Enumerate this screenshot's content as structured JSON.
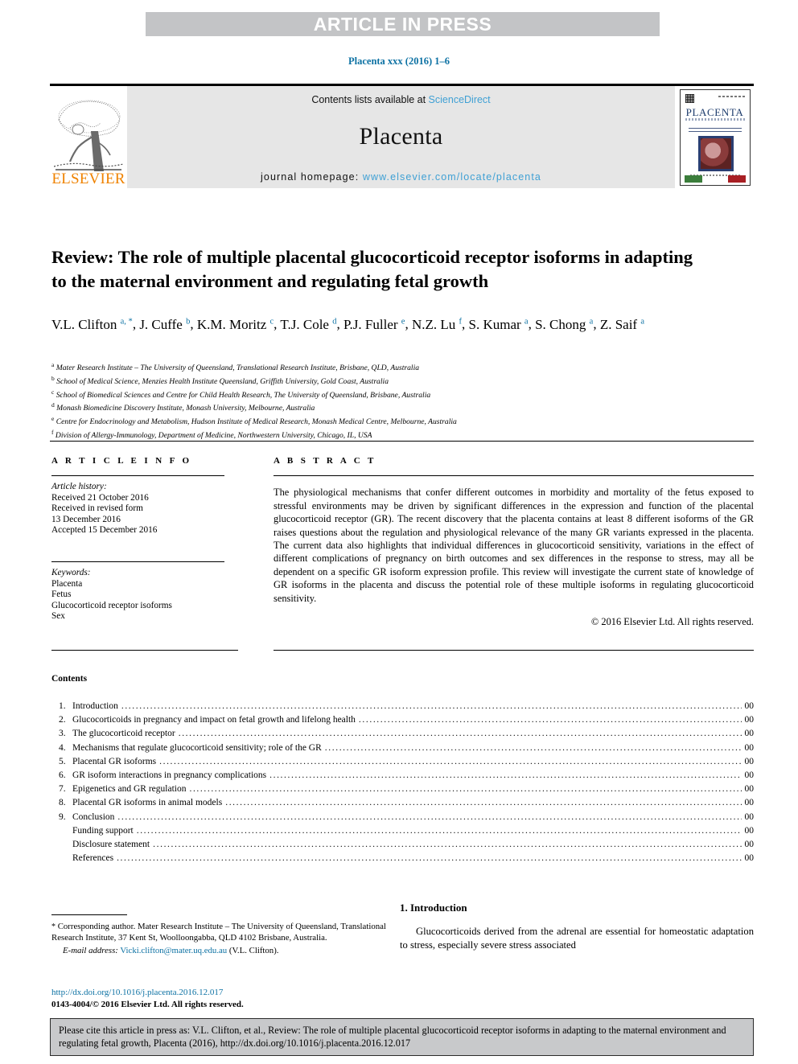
{
  "banner": {
    "text": "ARTICLE IN PRESS"
  },
  "running_head": "Placenta xxx (2016) 1–6",
  "masthead": {
    "contents_prefix": "Contents lists available at ",
    "sciencedirect": "ScienceDirect",
    "journal_title": "Placenta",
    "homepage_prefix": "journal homepage: ",
    "homepage_url": "www.elsevier.com/locate/placenta",
    "publisher_wordmark": "ELSEVIER",
    "cover_title": "PLACENTA"
  },
  "article": {
    "title": "Review: The role of multiple placental glucocorticoid receptor isoforms in adapting to the maternal environment and regulating fetal growth",
    "authors": [
      {
        "name": "V.L. Clifton",
        "marks": "a, *"
      },
      {
        "name": "J. Cuffe",
        "marks": "b"
      },
      {
        "name": "K.M. Moritz",
        "marks": "c"
      },
      {
        "name": "T.J. Cole",
        "marks": "d"
      },
      {
        "name": "P.J. Fuller",
        "marks": "e"
      },
      {
        "name": "N.Z. Lu",
        "marks": "f"
      },
      {
        "name": "S. Kumar",
        "marks": "a"
      },
      {
        "name": "S. Chong",
        "marks": "a"
      },
      {
        "name": "Z. Saif",
        "marks": "a"
      }
    ],
    "affiliations": [
      {
        "mark": "a",
        "text": "Mater Research Institute – The University of Queensland, Translational Research Institute, Brisbane, QLD, Australia"
      },
      {
        "mark": "b",
        "text": "School of Medical Science, Menzies Health Institute Queensland, Griffith University, Gold Coast, Australia"
      },
      {
        "mark": "c",
        "text": "School of Biomedical Sciences and Centre for Child Health Research, The University of Queensland, Brisbane, Australia"
      },
      {
        "mark": "d",
        "text": "Monash Biomedicine Discovery Institute, Monash University, Melbourne, Australia"
      },
      {
        "mark": "e",
        "text": "Centre for Endocrinology and Metabolism, Hudson Institute of Medical Research, Monash Medical Centre, Melbourne, Australia"
      },
      {
        "mark": "f",
        "text": "Division of Allergy-Immunology, Department of Medicine, Northwestern University, Chicago, IL, USA"
      }
    ]
  },
  "article_info": {
    "heading": "A R T I C L E  I N F O",
    "history_label": "Article history:",
    "history": [
      "Received 21 October 2016",
      "Received in revised form",
      "13 December 2016",
      "Accepted 15 December 2016"
    ],
    "keywords_label": "Keywords:",
    "keywords": [
      "Placenta",
      "Fetus",
      "Glucocorticoid receptor isoforms",
      "Sex"
    ]
  },
  "abstract": {
    "heading": "A B S T R A C T",
    "body": "The physiological mechanisms that confer different outcomes in morbidity and mortality of the fetus exposed to stressful environments may be driven by significant differences in the expression and function of the placental glucocorticoid receptor (GR). The recent discovery that the placenta contains at least 8 different isoforms of the GR raises questions about the regulation and physiological relevance of the many GR variants expressed in the placenta. The current data also highlights that individual differences in glucocorticoid sensitivity, variations in the effect of different complications of pregnancy on birth outcomes and sex differences in the response to stress, may all be dependent on a specific GR isoform expression profile. This review will investigate the current state of knowledge of GR isoforms in the placenta and discuss the potential role of these multiple isoforms in regulating glucocorticoid sensitivity.",
    "copyright": "© 2016 Elsevier Ltd. All rights reserved."
  },
  "contents": {
    "title": "Contents",
    "items": [
      {
        "num": "1.",
        "label": "Introduction",
        "page": "00"
      },
      {
        "num": "2.",
        "label": "Glucocorticoids in pregnancy and impact on fetal growth and lifelong health",
        "page": "00"
      },
      {
        "num": "3.",
        "label": "The glucocorticoid receptor",
        "page": "00"
      },
      {
        "num": "4.",
        "label": "Mechanisms that regulate glucocorticoid sensitivity; role of the GR",
        "page": "00"
      },
      {
        "num": "5.",
        "label": "Placental GR isoforms",
        "page": "00"
      },
      {
        "num": "6.",
        "label": "GR isoform interactions in pregnancy complications",
        "page": "00"
      },
      {
        "num": "7.",
        "label": "Epigenetics and GR regulation",
        "page": "00"
      },
      {
        "num": "8.",
        "label": "Placental GR isoforms in animal models",
        "page": "00"
      },
      {
        "num": "9.",
        "label": "Conclusion",
        "page": "00"
      },
      {
        "num": "",
        "label": "Funding support",
        "page": "00"
      },
      {
        "num": "",
        "label": "Disclosure statement",
        "page": "00"
      },
      {
        "num": "",
        "label": "References",
        "page": "00"
      }
    ]
  },
  "footer": {
    "corresponding_star": "*",
    "corresponding_text": "Corresponding author. Mater Research Institute – The University of Queensland, Translational Research Institute, 37 Kent St, Woolloongabba, QLD 4102 Brisbane, Australia.",
    "email_label": "E-mail address:",
    "email_address": "Vicki.clifton@mater.uq.edu.au",
    "email_owner": "(V.L. Clifton).",
    "doi": "http://dx.doi.org/10.1016/j.placenta.2016.12.017",
    "issn_line": "0143-4004/© 2016 Elsevier Ltd. All rights reserved."
  },
  "introduction": {
    "heading": "1. Introduction",
    "body": "Glucocorticoids derived from the adrenal are essential for homeostatic adaptation to stress, especially severe stress associated"
  },
  "cite_box": {
    "text": "Please cite this article in press as: V.L. Clifton, et al., Review: The role of multiple placental glucocorticoid receptor isoforms in adapting to the maternal environment and regulating fetal growth, Placenta (2016), http://dx.doi.org/10.1016/j.placenta.2016.12.017"
  },
  "colors": {
    "link": "#0c71a3",
    "link_light": "#3fa0d4",
    "banner_bg": "#c3c4c6",
    "masthead_bg": "#e6e6e6",
    "elsevier_orange": "#ef8200",
    "cite_bg": "#c8c9cb"
  }
}
